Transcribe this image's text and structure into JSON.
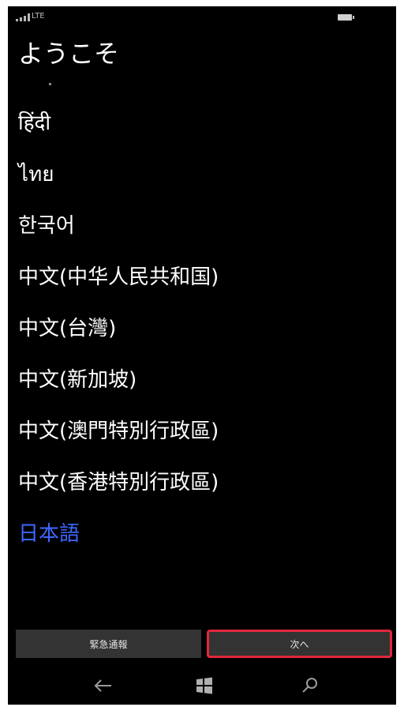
{
  "status_bar": {
    "network": "LTE"
  },
  "page": {
    "title": "ようこそ"
  },
  "languages": [
    {
      "label": "हिंदी"
    },
    {
      "label": "ไทย"
    },
    {
      "label": "한국어"
    },
    {
      "label": "中文(中华人民共和国)"
    },
    {
      "label": "中文(台灣)"
    },
    {
      "label": "中文(新加坡)"
    },
    {
      "label": "中文(澳門特別行政區)"
    },
    {
      "label": "中文(香港特別行政區)"
    },
    {
      "label": "日本語",
      "selected": true
    }
  ],
  "buttons": {
    "emergency_label": "緊急通報",
    "next_label": "次へ"
  },
  "colors": {
    "background": "#000000",
    "text": "#ffffff",
    "accent": "#3d67ff",
    "button": "#333333",
    "highlight_border": "#e0283c"
  },
  "icons": {
    "status": [
      "signal-icon",
      "battery-icon"
    ],
    "nav": [
      "back-arrow-icon",
      "windows-start-icon",
      "search-icon"
    ]
  }
}
